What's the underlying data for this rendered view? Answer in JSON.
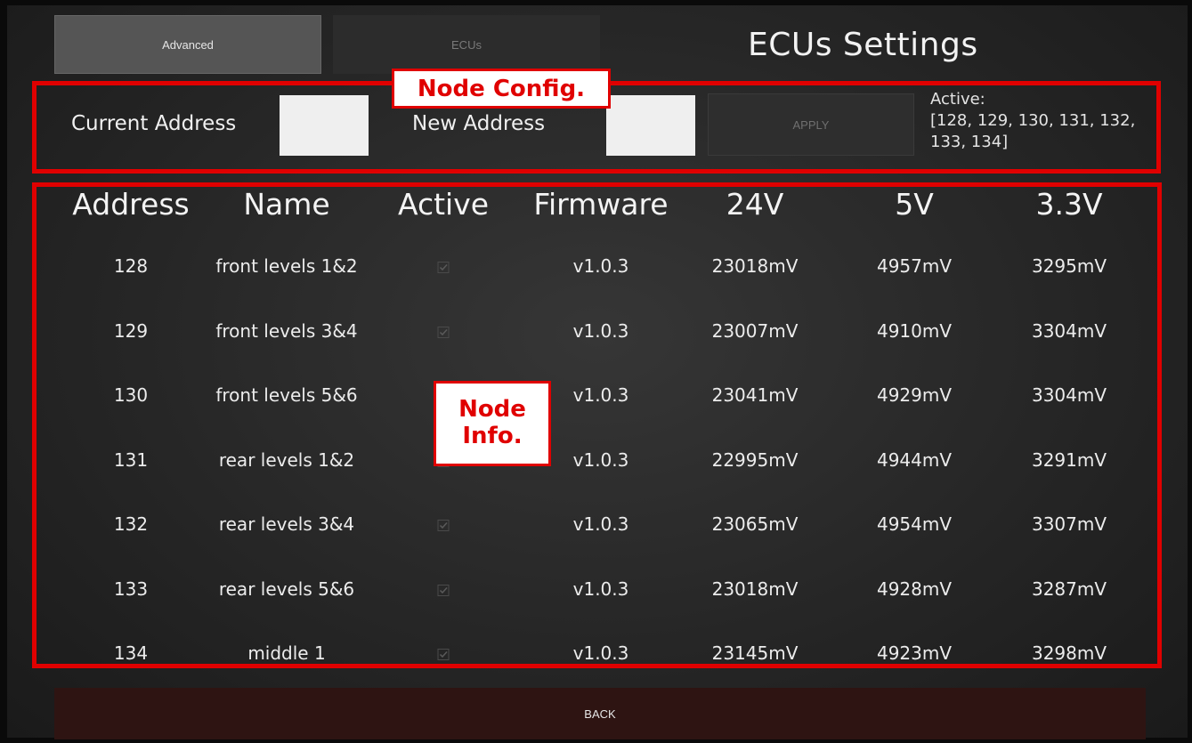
{
  "tabs": {
    "advanced": "Advanced",
    "ecus": "ECUs"
  },
  "page_title": "ECUs Settings",
  "annotations": {
    "node_config": "Node Config.",
    "node_info": "Node\nInfo."
  },
  "config": {
    "current_address_label": "Current Address",
    "current_address_value": "",
    "new_address_label": "New Address",
    "new_address_value": "",
    "apply_label": "APPLY",
    "active_label": "Active:",
    "active_list": "[128, 129, 130, 131, 132, 133, 134]"
  },
  "table": {
    "headers": [
      "Address",
      "Name",
      "Active",
      "Firmware",
      "24V",
      "5V",
      "3.3V"
    ],
    "rows": [
      {
        "address": "128",
        "name": "front levels 1&2",
        "active": true,
        "firmware": "v1.0.3",
        "v24": "23018mV",
        "v5": "4957mV",
        "v33": "3295mV"
      },
      {
        "address": "129",
        "name": "front levels 3&4",
        "active": true,
        "firmware": "v1.0.3",
        "v24": "23007mV",
        "v5": "4910mV",
        "v33": "3304mV"
      },
      {
        "address": "130",
        "name": "front levels 5&6",
        "active": true,
        "firmware": "v1.0.3",
        "v24": "23041mV",
        "v5": "4929mV",
        "v33": "3304mV"
      },
      {
        "address": "131",
        "name": "rear levels 1&2",
        "active": true,
        "firmware": "v1.0.3",
        "v24": "22995mV",
        "v5": "4944mV",
        "v33": "3291mV"
      },
      {
        "address": "132",
        "name": "rear levels 3&4",
        "active": true,
        "firmware": "v1.0.3",
        "v24": "23065mV",
        "v5": "4954mV",
        "v33": "3307mV"
      },
      {
        "address": "133",
        "name": "rear levels 5&6",
        "active": true,
        "firmware": "v1.0.3",
        "v24": "23018mV",
        "v5": "4928mV",
        "v33": "3287mV"
      },
      {
        "address": "134",
        "name": "middle 1",
        "active": true,
        "firmware": "v1.0.3",
        "v24": "23145mV",
        "v5": "4923mV",
        "v33": "3298mV"
      }
    ]
  },
  "back_label": "BACK",
  "colors": {
    "annotation": "#e00000",
    "back_button": "#2e1412"
  }
}
